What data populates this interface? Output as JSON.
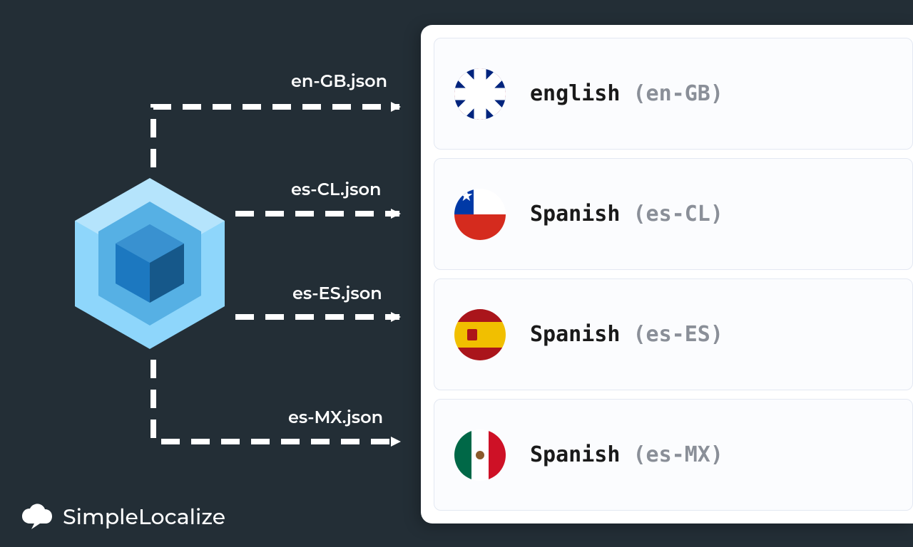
{
  "brand": {
    "name": "SimpleLocalize"
  },
  "files": [
    {
      "name": "en-GB.json"
    },
    {
      "name": "es-CL.json"
    },
    {
      "name": "es-ES.json"
    },
    {
      "name": "es-MX.json"
    }
  ],
  "locales": [
    {
      "language": "english",
      "code": "(en-GB)",
      "flag": "uk"
    },
    {
      "language": "Spanish",
      "code": "(es-CL)",
      "flag": "cl"
    },
    {
      "language": "Spanish",
      "code": "(es-ES)",
      "flag": "es"
    },
    {
      "language": "Spanish",
      "code": "(es-MX)",
      "flag": "mx"
    }
  ]
}
